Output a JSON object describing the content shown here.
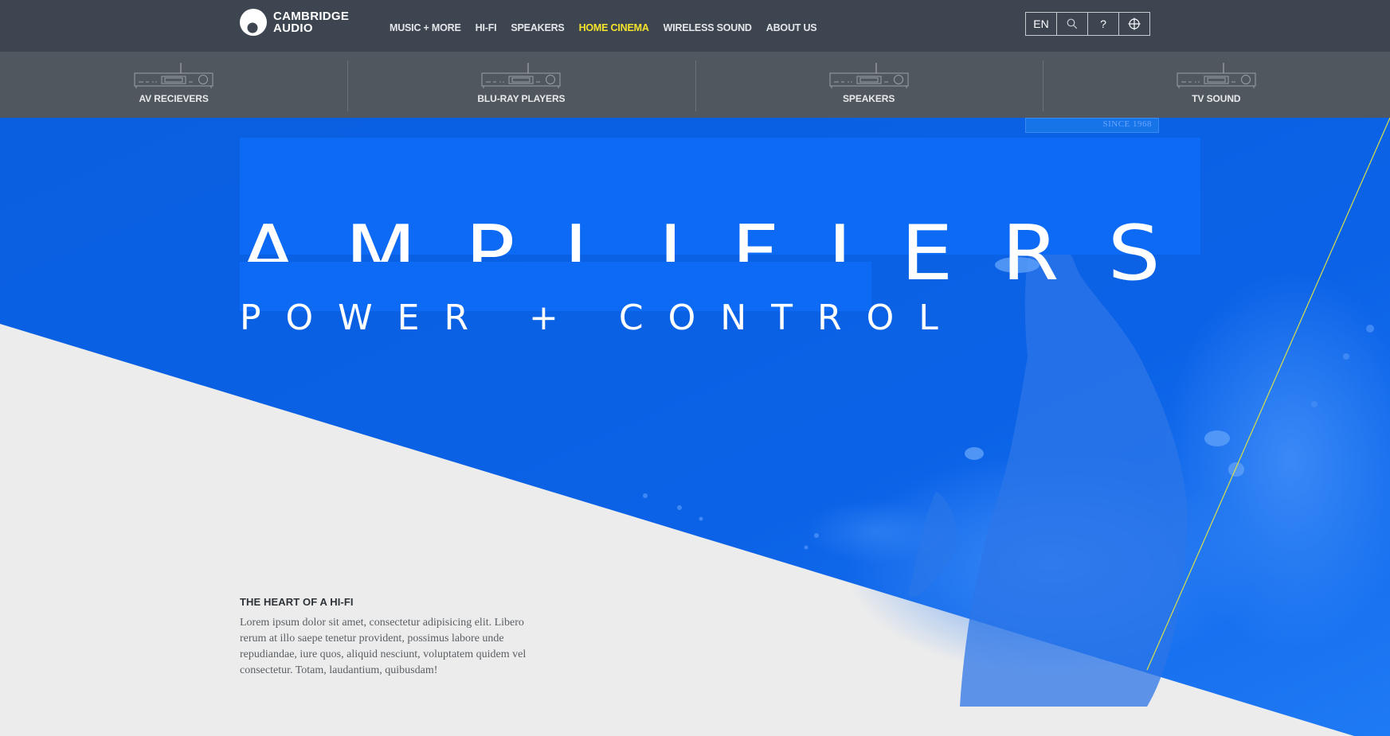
{
  "brand": {
    "line1": "CAMBRIDGE",
    "line2": "AUDIO"
  },
  "nav": {
    "items": [
      {
        "label": "MUSIC + MORE",
        "active": false
      },
      {
        "label": "HI-FI",
        "active": false
      },
      {
        "label": "SPEAKERS",
        "active": false
      },
      {
        "label": "HOME CINEMA",
        "active": true
      },
      {
        "label": "WIRELESS SOUND",
        "active": false
      },
      {
        "label": "ABOUT US",
        "active": false
      }
    ]
  },
  "utility": {
    "language": "EN",
    "search_icon": "search-icon",
    "help_label": "?",
    "locator_icon": "crosshair-icon"
  },
  "categories": [
    {
      "label": "AV RECIEVERS",
      "icon": "receiver-icon"
    },
    {
      "label": "BLU-RAY PLAYERS",
      "icon": "receiver-icon"
    },
    {
      "label": "SPEAKERS",
      "icon": "receiver-icon"
    },
    {
      "label": "TV SOUND",
      "icon": "receiver-icon"
    }
  ],
  "hero": {
    "badge": "SINCE 1968",
    "title": "AMPLIFIERS",
    "subtitle": "POWER + CONTROL"
  },
  "content": {
    "heading": "THE HEART OF A HI-FI",
    "body": "Lorem ipsum dolor sit amet, consectetur adipisicing elit. Libero rerum at illo saepe tenetur provident, possimus labore unde repudiandae, iure quos, aliquid nesciunt, voluptatem quidem vel consectetur. Totam, laudantium, quibusdam!"
  },
  "colors": {
    "nav_bg": "#3d4550",
    "category_bg": "#50575f",
    "active_nav": "#f4e32c",
    "hero_blue": "#0a5fe0",
    "title_box": "#0c6af5",
    "page_bg": "#ececec",
    "accent_line": "#d6e04a"
  }
}
